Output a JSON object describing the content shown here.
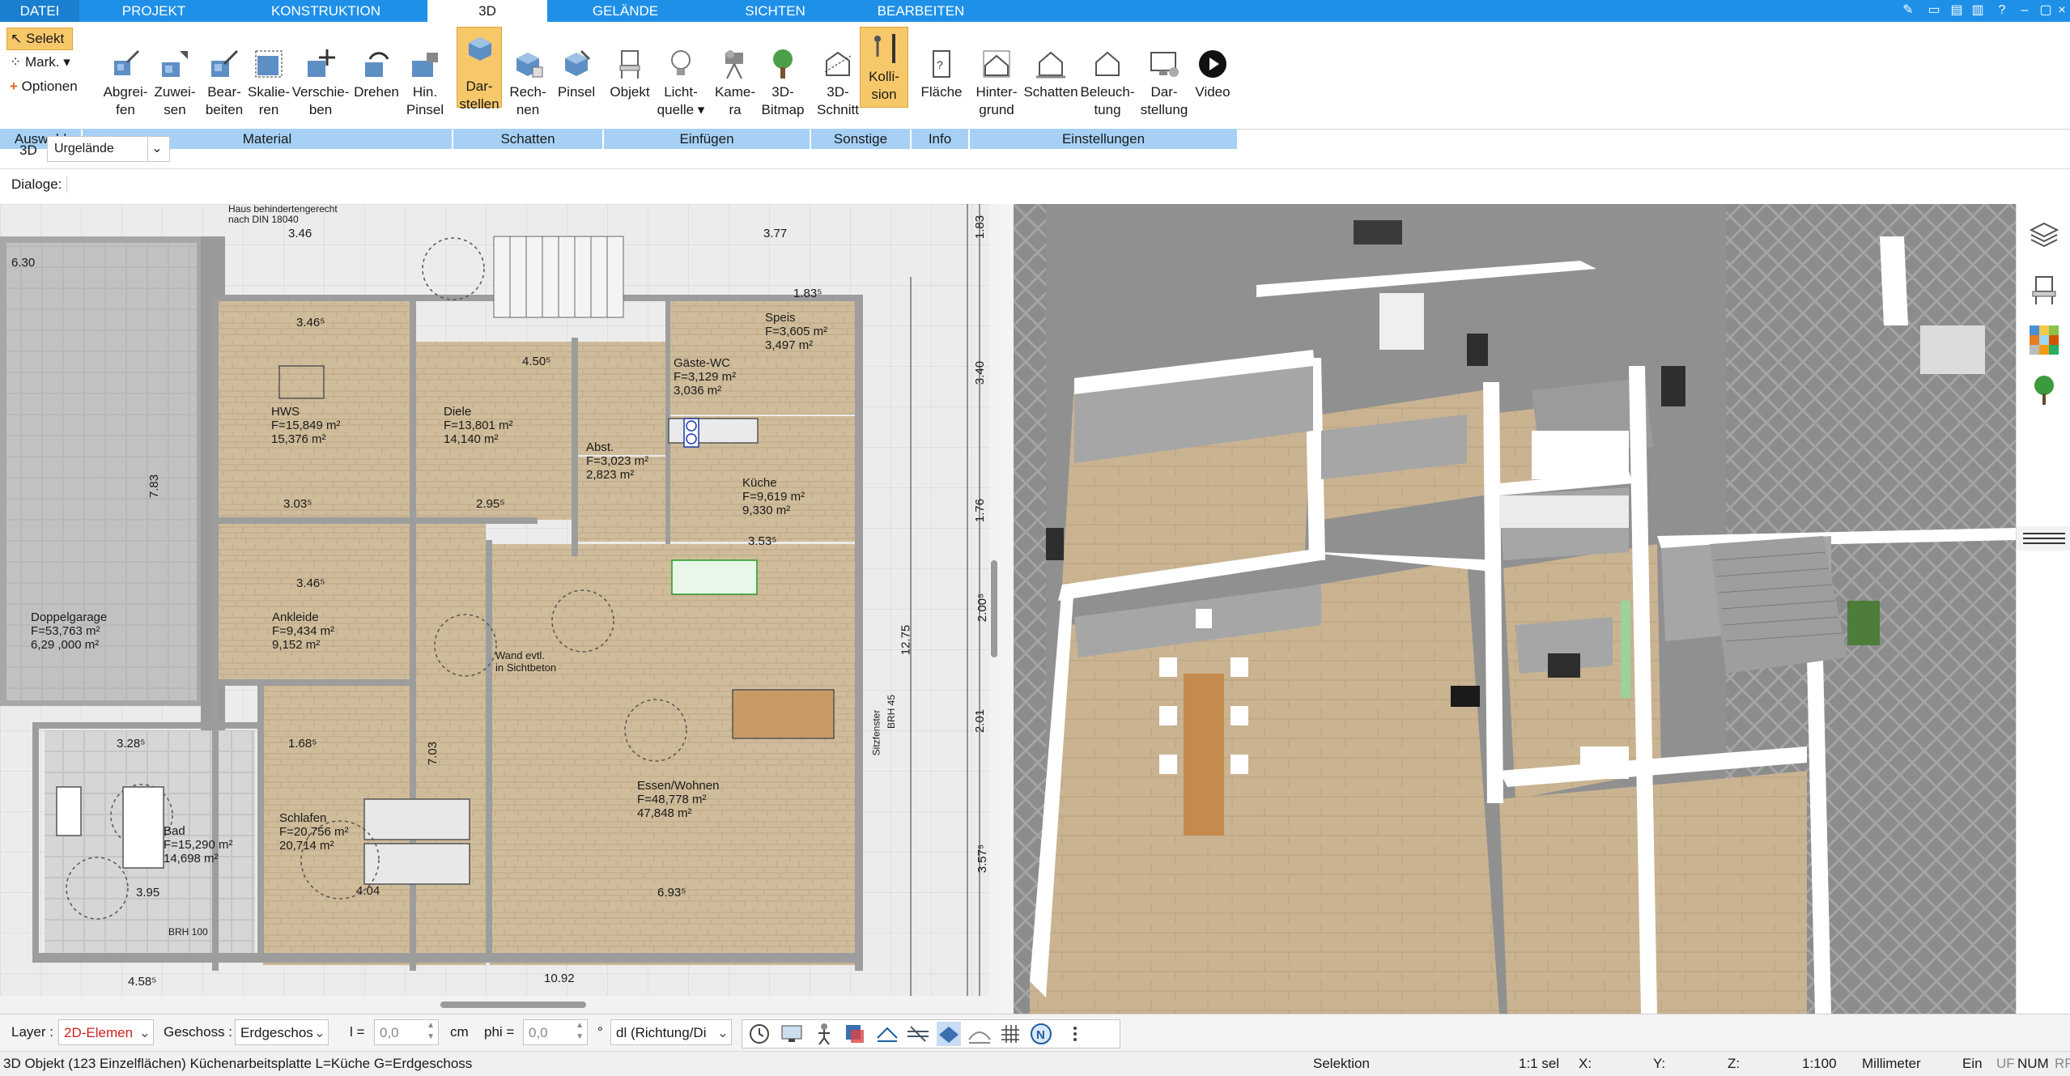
{
  "tabs": [
    {
      "label": "DATEI",
      "active": false
    },
    {
      "label": "PROJEKT",
      "active": false
    },
    {
      "label": "KONSTRUKTION",
      "active": false
    },
    {
      "label": "3D",
      "active": true
    },
    {
      "label": "GELÄNDE",
      "active": false
    },
    {
      "label": "SICHTEN",
      "active": false
    },
    {
      "label": "BEARBEITEN",
      "active": false
    }
  ],
  "auswahl": {
    "selekt": "Selekt",
    "mark": "Mark.",
    "optionen": "Optionen"
  },
  "ribbon_buttons": [
    {
      "l1": "Abgrei-",
      "l2": "fen",
      "icon": "eyedropper-icon"
    },
    {
      "l1": "Zuwei-",
      "l2": "sen",
      "icon": "assign-material-icon"
    },
    {
      "l1": "Bear-",
      "l2": "beiten",
      "icon": "edit-material-icon"
    },
    {
      "l1": "Skalie-",
      "l2": "ren",
      "icon": "scale-icon"
    },
    {
      "l1": "Verschie-",
      "l2": "ben",
      "icon": "move-icon"
    },
    {
      "l1": "Drehen",
      "l2": "",
      "icon": "rotate-icon"
    },
    {
      "l1": "Hin.",
      "l2": "Pinsel",
      "icon": "brush-back-icon"
    },
    {
      "l1": "Dar-",
      "l2": "stellen",
      "icon": "display-cube-icon"
    },
    {
      "l1": "Rech-",
      "l2": "nen",
      "icon": "calculate-cube-icon"
    },
    {
      "l1": "Pinsel",
      "l2": "",
      "icon": "brush-cube-icon"
    },
    {
      "l1": "Objekt",
      "l2": "",
      "icon": "chair-icon"
    },
    {
      "l1": "Licht-",
      "l2": "quelle",
      "icon": "lightbulb-icon"
    },
    {
      "l1": "Kame-",
      "l2": "ra",
      "icon": "camera-icon"
    },
    {
      "l1": "3D-",
      "l2": "Bitmap",
      "icon": "tree-icon"
    },
    {
      "l1": "3D-",
      "l2": "Schnitt",
      "icon": "section-icon"
    },
    {
      "l1": "Kolli-",
      "l2": "sion",
      "icon": "collision-icon"
    },
    {
      "l1": "Fläche",
      "l2": "",
      "icon": "area-icon"
    },
    {
      "l1": "Hinter-",
      "l2": "grund",
      "icon": "background-icon"
    },
    {
      "l1": "Schatten",
      "l2": "",
      "icon": "shadow-house-icon"
    },
    {
      "l1": "Beleuch-",
      "l2": "tung",
      "icon": "lighting-house-icon"
    },
    {
      "l1": "Dar-",
      "l2": "stellung",
      "icon": "monitor-icon"
    },
    {
      "l1": "Video",
      "l2": "",
      "icon": "play-icon"
    }
  ],
  "groups": [
    "Auswahl",
    "Material",
    "Schatten",
    "Einfügen",
    "Sonstige",
    "Info",
    "Einstellungen"
  ],
  "view_selector": {
    "mode": "3D",
    "value": "Urgelände"
  },
  "dialoge_label": "Dialoge:",
  "plan_labels": {
    "hws": "HWS",
    "hws_f": "F=15,849 m²",
    "hws_f2": "15,376 m²",
    "diele": "Diele",
    "diele_f": "F=13,801 m²",
    "diele_f2": "14,140 m²",
    "gaeste": "Gäste-WC",
    "gaeste_f": "F=3,129 m²",
    "gaeste_f2": "3,036 m²",
    "speis": "Speis",
    "speis_f": "F=3,605 m²",
    "speis_f2": "3,497 m²",
    "abst": "Abst.",
    "abst_f": "F=3,023 m²",
    "abst_f2": "2,823 m²",
    "kueche": "Küche",
    "kueche_f": "F=9,619 m²",
    "kueche_f2": "9,330 m²",
    "ankleide": "Ankleide",
    "ankleide_f": "F=9,434 m²",
    "ankleide_f2": "9,152 m²",
    "garage": "Doppelgarage",
    "garage_f": "F=53,763 m²",
    "garage_f2": "6,29  ,000 m²",
    "bad": "Bad",
    "bad_f": "F=15,290 m²",
    "bad_f2": "14,698 m²",
    "schlafen": "Schlafen",
    "schlafen_f": "F=20,756 m²",
    "schlafen_f2": "20,714 m²",
    "essen": "Essen/Wohnen",
    "essen_f": "F=48,778 m²",
    "essen_f2": "47,848 m²",
    "wand": "Wand evtl.",
    "wand2": "in Sichtbeton",
    "dims": [
      "3.46",
      "3.77",
      "6.30",
      "4.50⁵",
      "3.46⁵",
      "3.03⁵",
      "2.95⁵",
      "3.46⁵",
      "1.68⁵",
      "4.04",
      "6.93⁵",
      "10.92",
      "4.58⁵",
      "3.28⁵",
      "3.95",
      "7.83",
      "7.03",
      "12.75",
      "1.83",
      "3.40",
      "1.76",
      "2.00⁵",
      "2.01",
      "3.57⁵",
      "3.53⁵",
      "1.83⁵"
    ],
    "haus_note": "Haus behindertengerecht",
    "haus_note2": "nach DIN 18040",
    "brh100": "BRH 100",
    "brh45": "BRH 45",
    "sitzfenster": "Sitzfenster"
  },
  "bottom": {
    "layer_label": "Layer :",
    "layer_value": "2D-Elemen",
    "geschoss_label": "Geschoss :",
    "geschoss_value": "Erdgeschos",
    "l_label": "l =",
    "l_value": "0,0",
    "unit": "cm",
    "phi_label": "phi =",
    "phi_value": "0,0",
    "deg": "°",
    "dl_value": "dl (Richtung/Di"
  },
  "status": {
    "info": "3D Objekt (123 Einzelflächen) Küchenarbeitsplatte L=Küche G=Erdgeschoss",
    "mode": "Selektion",
    "sel": "1:1 sel",
    "x": "X:",
    "y": "Y:",
    "z": "Z:",
    "scale": "1:100",
    "unit": "Millimeter",
    "ein": "Ein",
    "uf": "UF",
    "num": "NUM",
    "rf": "RF"
  },
  "colors": {
    "tabbar": "#1e90e8",
    "groupbar": "#a6d1f5",
    "selected": "#f7c86a",
    "floor": "#c9b391",
    "wall": "#ffffff"
  }
}
